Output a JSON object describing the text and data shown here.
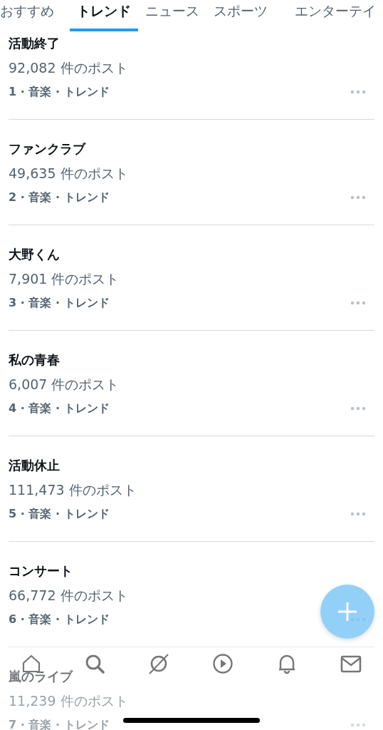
{
  "tabs": [
    {
      "label": "おすすめ",
      "selected": false
    },
    {
      "label": "トレンド",
      "selected": true
    },
    {
      "label": "ニュース",
      "selected": false
    },
    {
      "label": "スポーツ",
      "selected": false
    },
    {
      "label": "エンターテイ",
      "selected": false
    }
  ],
  "trends": [
    {
      "title": "活動終了",
      "posts": "92,082 件のポスト",
      "meta": "1 · 音楽 · トレンド"
    },
    {
      "title": "ファンクラブ",
      "posts": "49,635 件のポスト",
      "meta": "2 · 音楽 · トレンド"
    },
    {
      "title": "大野くん",
      "posts": "7,901 件のポスト",
      "meta": "3 · 音楽 · トレンド"
    },
    {
      "title": "私の青春",
      "posts": "6,007 件のポスト",
      "meta": "4 · 音楽 · トレンド"
    },
    {
      "title": "活動休止",
      "posts": "111,473 件のポスト",
      "meta": "5 · 音楽 · トレンド"
    },
    {
      "title": "コンサート",
      "posts": "66,772 件のポスト",
      "meta": "6 · 音楽 · トレンド"
    },
    {
      "title": "嵐のライブ",
      "posts": "11,239 件のポスト",
      "meta": "7 · 音楽 · トレンド"
    }
  ]
}
